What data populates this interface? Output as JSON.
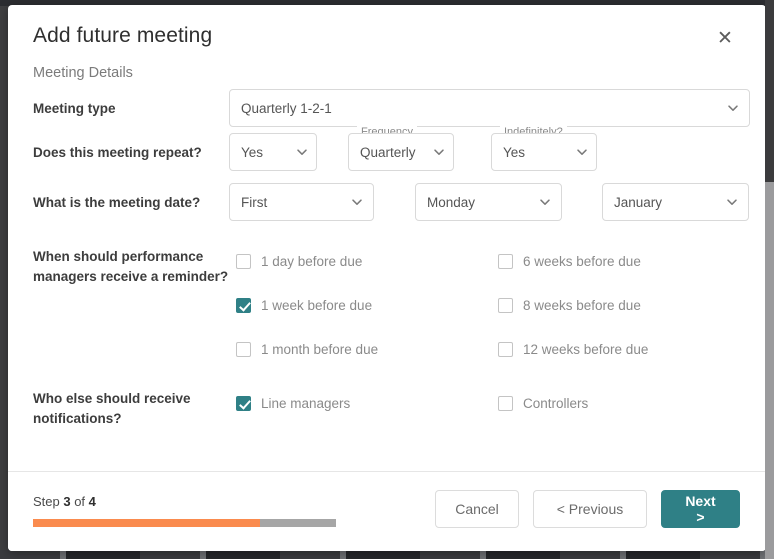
{
  "modal": {
    "title": "Add future meeting",
    "close_icon": "close-icon",
    "section_title": "Meeting Details",
    "rows": [
      {
        "label": "Meeting type",
        "fields": [
          {
            "type": "select",
            "value": "Quarterly 1-2-1",
            "legend": ""
          }
        ]
      },
      {
        "label": "Does this meeting repeat?",
        "fields": [
          {
            "type": "select",
            "value": "Yes",
            "legend": ""
          },
          {
            "type": "select",
            "value": "Quarterly",
            "legend": "Frequency"
          },
          {
            "type": "select",
            "value": "Yes",
            "legend": "Indefinitely?"
          }
        ]
      },
      {
        "label": "What is the meeting date?",
        "fields": [
          {
            "type": "select",
            "value": "First",
            "legend": ""
          },
          {
            "type": "select",
            "value": "Monday",
            "legend": ""
          },
          {
            "type": "select",
            "value": "January",
            "legend": ""
          }
        ]
      }
    ],
    "reminder": {
      "label": "When should performance managers receive a reminder?",
      "options": [
        {
          "label": "1 day before due",
          "checked": false
        },
        {
          "label": "6 weeks before due",
          "checked": false
        },
        {
          "label": "1 week before due",
          "checked": true
        },
        {
          "label": "8 weeks before due",
          "checked": false
        },
        {
          "label": "1 month before due",
          "checked": false
        },
        {
          "label": "12 weeks before due",
          "checked": false
        }
      ]
    },
    "notifications": {
      "label": "Who else should receive notifications?",
      "options": [
        {
          "label": "Line managers",
          "checked": true
        },
        {
          "label": "Controllers",
          "checked": false
        }
      ]
    },
    "footer": {
      "step_prefix": "Step ",
      "step_current": "3",
      "step_middle": " of ",
      "step_total": "4",
      "progress_percent": 75,
      "buttons": {
        "cancel": "Cancel",
        "previous": "< Previous",
        "next": "Next >"
      }
    },
    "colors": {
      "accent_teal": "#2f8086",
      "progress_fill": "#fa8b4e",
      "progress_track": "#a6a6a6"
    }
  }
}
